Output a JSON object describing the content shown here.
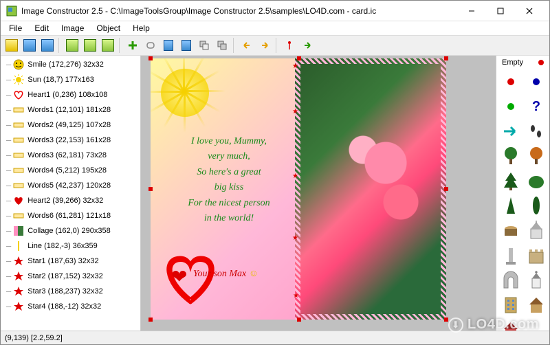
{
  "title": "Image Constructor 2.5 - C:\\ImageToolsGroup\\Image Constructor 2.5\\samples\\LO4D.com - card.ic",
  "menu": [
    "File",
    "Edit",
    "Image",
    "Object",
    "Help"
  ],
  "toolbar": {
    "tips": [
      "New",
      "Open",
      "Save",
      "Export",
      "Import",
      "Download",
      "Add",
      "Link",
      "Copy-Doc",
      "Paste-Doc",
      "Layers",
      "Group",
      "Arrow-Left",
      "Arrow-Right",
      "Anchor",
      "Goto"
    ]
  },
  "tree": [
    {
      "icon": "smile",
      "label": "Smile (172,276) 32x32"
    },
    {
      "icon": "sun",
      "label": "Sun (18,7) 177x163"
    },
    {
      "icon": "heart",
      "label": "Heart1 (0,236) 108x108"
    },
    {
      "icon": "text",
      "label": "Words1 (12,101) 181x28"
    },
    {
      "icon": "text",
      "label": "Words2 (49,125) 107x28"
    },
    {
      "icon": "text",
      "label": "Words3 (22,153) 161x28"
    },
    {
      "icon": "text",
      "label": "Words3 (62,181) 73x28"
    },
    {
      "icon": "text",
      "label": "Words4 (5,212) 195x28"
    },
    {
      "icon": "text",
      "label": "Words5 (42,237) 120x28"
    },
    {
      "icon": "heart2",
      "label": "Heart2 (39,266) 32x32"
    },
    {
      "icon": "text",
      "label": "Words6 (61,281) 121x18"
    },
    {
      "icon": "collage",
      "label": "Collage (162,0) 290x358"
    },
    {
      "icon": "line",
      "label": "Line (182,-3) 36x359"
    },
    {
      "icon": "star",
      "label": "Star1 (187,63) 32x32"
    },
    {
      "icon": "star",
      "label": "Star2 (187,152) 32x32"
    },
    {
      "icon": "star",
      "label": "Star3 (188,237) 32x32"
    },
    {
      "icon": "star",
      "label": "Star4 (188,-12) 32x32"
    }
  ],
  "poem": {
    "l1": "I love you, Mummy,",
    "l2": "very much,",
    "l3": "So here's a great",
    "l4": "big kiss",
    "l5": "For the nicest person",
    "l6": "in the world!",
    "sig": "Your son Max"
  },
  "palette": {
    "label": "Empty",
    "items": [
      "red-dot",
      "blue-dot",
      "green-dot",
      "question",
      "arrow-right",
      "footprints",
      "tree-round",
      "tree-autumn",
      "pine",
      "bush",
      "conifer",
      "cypress",
      "stump",
      "church",
      "monument",
      "castle",
      "arch",
      "chapel",
      "building",
      "house-brown",
      "house-red"
    ]
  },
  "status": "(9,139) [2.2,59.2]",
  "watermark": "LO4D.com"
}
